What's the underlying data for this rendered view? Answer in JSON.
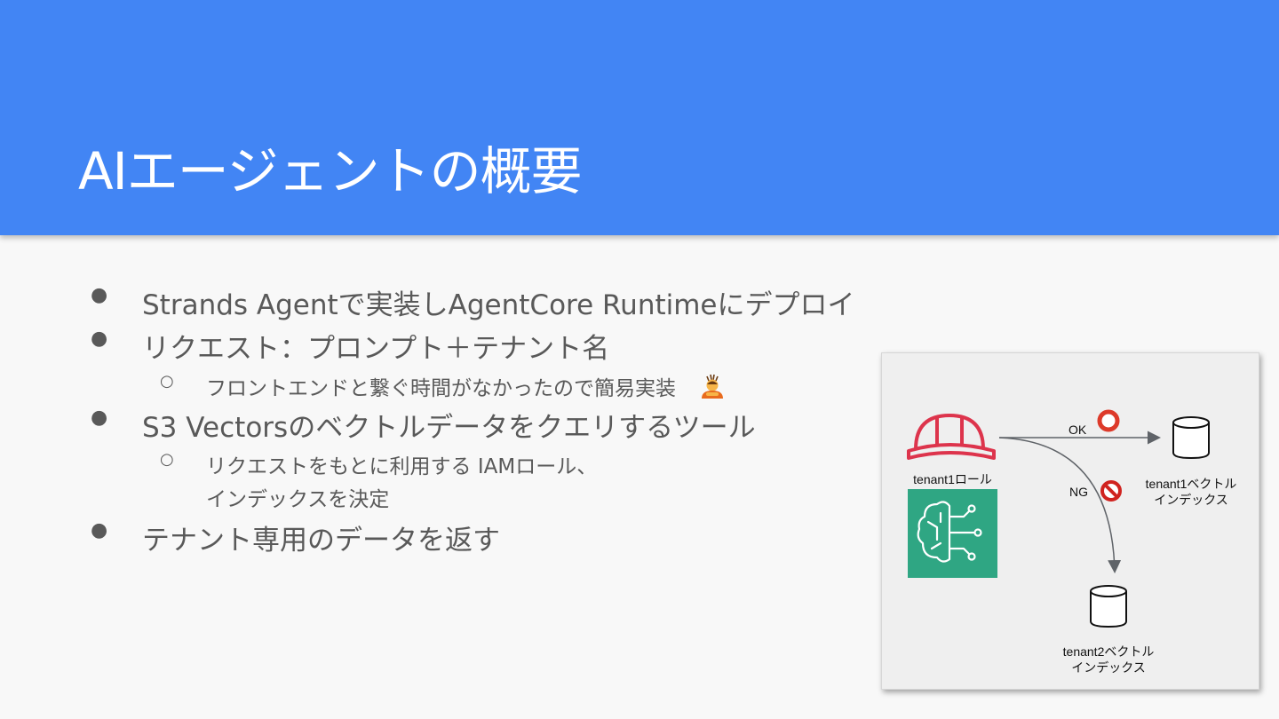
{
  "slide": {
    "title": "AIエージェントの概要",
    "colors": {
      "header": "#4285f4",
      "background": "#f8f8f8",
      "text": "#595959"
    }
  },
  "bullets": [
    {
      "level": 1,
      "text": "Strands Agentで実装しAgentCore Runtimeにデプロイ"
    },
    {
      "level": 1,
      "text": "リクエスト：プロンプト＋テナント名"
    },
    {
      "level": 2,
      "text": "フロントエンドと繋ぐ時間がなかったので簡易実装",
      "icon": "bowing-person-emoji"
    },
    {
      "level": 1,
      "text": "S3 Vectorsのベクトルデータをクエリするツール"
    },
    {
      "level": 2,
      "text": "リクエストをもとに利用する IAMロール、"
    },
    {
      "level": 2,
      "text": "インデックスを決定",
      "continuation": true
    },
    {
      "level": 1,
      "text": "テナント専用のデータを返す"
    }
  ],
  "diagram": {
    "role_label": "tenant1ロール",
    "ok_label": "OK",
    "ng_label": "NG",
    "index1_line1": "tenant1ベクトル",
    "index1_line2": "インデックス",
    "index2_line1": "tenant2ベクトル",
    "index2_line2": "インデックス",
    "icons": [
      "iam-role-helmet-icon",
      "bedrock-agentcore-icon",
      "database-icon",
      "allowed-circle-icon",
      "prohibited-icon"
    ],
    "colors": {
      "role": "#dd344c",
      "agentcore": "#2fa683",
      "ok": "#dd3a2a",
      "ng": "#d0231f",
      "arrow": "#5f6368"
    }
  }
}
